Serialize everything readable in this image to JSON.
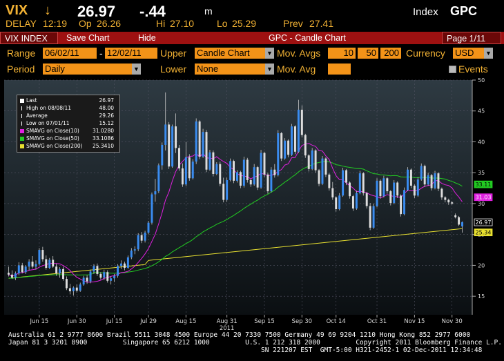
{
  "header": {
    "ticker": "VIX",
    "arrow": "↓",
    "price": "26.97",
    "change": "-.44",
    "unit": "m",
    "index_label": "Index",
    "index_code": "GPC",
    "delay": "DELAY",
    "time": "12:19",
    "op_label": "Op",
    "op": "26.26",
    "hi_label": "Hi",
    "hi": "27.10",
    "lo_label": "Lo",
    "lo": "25.29",
    "prev_label": "Prev",
    "prev": "27.41"
  },
  "toolbar": {
    "tab": "VIX INDEX",
    "save_chart": "Save Chart",
    "hide": "Hide",
    "title": "GPC - Candle Chart",
    "page": "Page 1/11"
  },
  "controls": {
    "range_label": "Range",
    "range_from": "06/02/11",
    "range_sep": "-",
    "range_to": "12/02/11",
    "upper_label": "Upper",
    "upper_value": "Candle Chart",
    "movavgs_label": "Mov. Avgs",
    "ma1": "10",
    "ma2": "50",
    "ma3": "200",
    "currency_label": "Currency",
    "currency_value": "USD",
    "period_label": "Period",
    "period_value": "Daily",
    "lower_label": "Lower",
    "lower_value": "None",
    "movavg_label": "Mov. Avg",
    "movavg_value": "",
    "events_label": "Events"
  },
  "legend": [
    {
      "label": "Last",
      "value": "26.97",
      "color": "#ffffff",
      "kind": "box"
    },
    {
      "label": "High on 08/08/11",
      "value": "48.00",
      "color": "#ffffff",
      "kind": "high"
    },
    {
      "label": "Average",
      "value": "29.26",
      "color": "#ffffff",
      "kind": "avg"
    },
    {
      "label": "Low on 07/01/11",
      "value": "15.12",
      "color": "#ffffff",
      "kind": "low"
    },
    {
      "label": "SMAVG on Close(10)",
      "value": "31.0280",
      "color": "#e020e0",
      "kind": "box"
    },
    {
      "label": "SMAVG on Close(50)",
      "value": "33.1086",
      "color": "#22cc22",
      "kind": "box"
    },
    {
      "label": "SMAVG on Close(200)",
      "value": "25.3410",
      "color": "#e8e030",
      "kind": "box"
    }
  ],
  "footer": {
    "line1": "Australia 61 2 9777 8600 Brazil 5511 3048 4500 Europe 44 20 7330 7500 Germany 49 69 9204 1210 Hong Kong 852 2977 6000",
    "line2": "Japan 81 3 3201 8900         Singapore 65 6212 1000         U.S. 1 212 318 2000         Copyright 2011 Bloomberg Finance L.P.",
    "line3": "SN 221207 EST  GMT-5:00 H321-2452-1 02-Dec-2011 12:34:48"
  },
  "chart_data": {
    "type": "candlestick",
    "ylim": [
      12,
      50
    ],
    "yticks": [
      15,
      20,
      25,
      30,
      35,
      40,
      45,
      50
    ],
    "xtick_labels": [
      "Jun 15",
      "Jun 30",
      "Jul 15",
      "Jul 29",
      "Aug 15",
      "Aug 31",
      "Sep 15",
      "Sep 30",
      "Oct 14",
      "Oct 31",
      "Nov 15",
      "Nov 30"
    ],
    "xtick_index": [
      9,
      20,
      31,
      41,
      52,
      64,
      75,
      86,
      96,
      108,
      119,
      130
    ],
    "year_label": "2011",
    "year_index": 64,
    "colors": {
      "up": "#3a8cf0",
      "down": "#dddddd",
      "ma10": "#e020e0",
      "ma50": "#22cc22",
      "ma200": "#e8e030"
    },
    "right_labels": [
      {
        "text": "33.11",
        "value": 33.11,
        "bg": "#22cc22",
        "fg": "#000"
      },
      {
        "text": "31.03",
        "value": 31.03,
        "bg": "#e020e0",
        "fg": "#fff"
      },
      {
        "text": "26.97",
        "value": 26.97,
        "bg": "#000000",
        "fg": "#fff"
      },
      {
        "text": "25.34",
        "value": 25.34,
        "bg": "#e8e030",
        "fg": "#000"
      }
    ],
    "candles": [
      [
        18.8,
        19.8,
        18.2,
        18.5
      ],
      [
        18.5,
        19.2,
        17.8,
        18.0
      ],
      [
        18.0,
        19.0,
        17.6,
        18.7
      ],
      [
        18.7,
        20.5,
        18.4,
        20.0
      ],
      [
        20.0,
        20.4,
        18.7,
        18.9
      ],
      [
        18.9,
        20.0,
        18.6,
        19.8
      ],
      [
        19.8,
        21.0,
        19.2,
        20.6
      ],
      [
        20.6,
        21.5,
        19.5,
        19.8
      ],
      [
        19.8,
        20.8,
        19.3,
        20.2
      ],
      [
        20.2,
        22.8,
        20.0,
        22.5
      ],
      [
        22.5,
        23.0,
        20.6,
        21.0
      ],
      [
        21.0,
        21.6,
        19.3,
        19.6
      ],
      [
        19.6,
        21.2,
        19.4,
        20.9
      ],
      [
        20.9,
        21.5,
        19.6,
        19.8
      ],
      [
        19.8,
        20.3,
        18.3,
        18.7
      ],
      [
        18.7,
        19.7,
        18.0,
        19.4
      ],
      [
        19.4,
        19.8,
        17.5,
        17.8
      ],
      [
        17.8,
        18.2,
        16.0,
        16.3
      ],
      [
        16.3,
        17.0,
        15.3,
        15.8
      ],
      [
        15.8,
        16.6,
        15.1,
        16.4
      ],
      [
        16.4,
        16.9,
        15.6,
        15.9
      ],
      [
        15.9,
        17.2,
        15.7,
        16.9
      ],
      [
        16.9,
        18.3,
        16.7,
        18.0
      ],
      [
        18.0,
        18.4,
        17.0,
        17.4
      ],
      [
        17.4,
        19.3,
        17.1,
        19.0
      ],
      [
        19.0,
        20.2,
        18.6,
        19.9
      ],
      [
        19.9,
        20.3,
        18.3,
        18.6
      ],
      [
        18.6,
        18.9,
        17.7,
        18.0
      ],
      [
        18.0,
        19.3,
        17.6,
        18.9
      ],
      [
        18.9,
        19.2,
        17.2,
        17.5
      ],
      [
        17.5,
        18.2,
        16.9,
        17.9
      ],
      [
        17.9,
        18.6,
        17.3,
        18.3
      ],
      [
        18.3,
        20.2,
        18.0,
        19.9
      ],
      [
        19.9,
        20.8,
        19.4,
        20.3
      ],
      [
        20.3,
        20.6,
        19.2,
        19.6
      ],
      [
        19.6,
        21.6,
        19.4,
        21.3
      ],
      [
        21.3,
        22.8,
        21.0,
        22.4
      ],
      [
        22.4,
        23.1,
        21.8,
        22.6
      ],
      [
        22.6,
        25.2,
        22.3,
        24.9
      ],
      [
        24.9,
        25.4,
        23.6,
        24.0
      ],
      [
        24.0,
        25.6,
        23.7,
        25.3
      ],
      [
        25.3,
        27.2,
        25.0,
        26.9
      ],
      [
        26.9,
        31.8,
        26.6,
        31.5
      ],
      [
        31.5,
        34.0,
        30.3,
        32.0
      ],
      [
        32.0,
        36.5,
        31.7,
        36.2
      ],
      [
        36.2,
        39.9,
        35.5,
        39.5
      ],
      [
        39.5,
        48.0,
        38.6,
        42.8
      ],
      [
        42.8,
        43.2,
        35.6,
        36.0
      ],
      [
        36.0,
        42.8,
        35.8,
        42.5
      ],
      [
        42.5,
        44.6,
        38.2,
        39.0
      ],
      [
        39.0,
        39.5,
        35.3,
        35.7
      ],
      [
        35.7,
        36.5,
        32.7,
        33.1
      ],
      [
        33.1,
        40.0,
        32.8,
        37.5
      ],
      [
        37.5,
        38.0,
        33.7,
        34.1
      ],
      [
        34.1,
        37.2,
        33.9,
        36.8
      ],
      [
        36.8,
        43.8,
        36.4,
        43.3
      ],
      [
        43.3,
        43.5,
        37.2,
        37.6
      ],
      [
        37.6,
        42.1,
        37.4,
        41.6
      ],
      [
        41.6,
        41.9,
        35.1,
        35.5
      ],
      [
        35.5,
        38.7,
        35.3,
        38.3
      ],
      [
        38.3,
        38.6,
        34.4,
        34.8
      ],
      [
        34.8,
        36.7,
        34.6,
        36.4
      ],
      [
        36.4,
        36.8,
        32.8,
        33.2
      ],
      [
        33.2,
        34.2,
        30.2,
        30.6
      ],
      [
        30.6,
        34.2,
        30.3,
        33.8
      ],
      [
        33.8,
        37.3,
        33.6,
        36.9
      ],
      [
        36.9,
        37.1,
        33.3,
        33.7
      ],
      [
        33.7,
        35.4,
        33.4,
        35.1
      ],
      [
        35.1,
        35.3,
        32.5,
        32.9
      ],
      [
        32.9,
        37.6,
        32.6,
        37.1
      ],
      [
        37.1,
        37.4,
        33.4,
        33.8
      ],
      [
        33.8,
        34.0,
        32.7,
        33.1
      ],
      [
        33.1,
        36.4,
        32.9,
        35.9
      ],
      [
        35.9,
        36.1,
        32.2,
        32.6
      ],
      [
        32.6,
        38.7,
        32.4,
        38.2
      ],
      [
        38.2,
        38.4,
        34.3,
        34.7
      ],
      [
        34.7,
        35.0,
        31.6,
        32.0
      ],
      [
        32.0,
        35.9,
        31.8,
        35.5
      ],
      [
        35.5,
        36.4,
        34.2,
        34.6
      ],
      [
        34.6,
        41.9,
        34.4,
        41.4
      ],
      [
        41.4,
        41.6,
        36.9,
        37.3
      ],
      [
        37.3,
        40.6,
        37.1,
        40.2
      ],
      [
        40.2,
        40.4,
        37.5,
        37.9
      ],
      [
        37.9,
        42.9,
        37.7,
        42.5
      ],
      [
        42.5,
        42.7,
        38.0,
        38.4
      ],
      [
        38.4,
        46.8,
        38.2,
        45.2
      ],
      [
        45.2,
        45.9,
        40.7,
        41.1
      ],
      [
        41.1,
        41.3,
        37.4,
        37.8
      ],
      [
        37.8,
        38.0,
        35.2,
        35.6
      ],
      [
        35.6,
        39.0,
        35.4,
        38.6
      ],
      [
        38.6,
        38.8,
        35.0,
        35.4
      ],
      [
        35.4,
        35.6,
        32.8,
        33.2
      ],
      [
        33.2,
        37.7,
        33.0,
        37.3
      ],
      [
        37.3,
        37.5,
        34.3,
        34.7
      ],
      [
        34.7,
        34.9,
        32.1,
        32.5
      ],
      [
        32.5,
        33.5,
        30.6,
        31.0
      ],
      [
        31.0,
        31.2,
        28.7,
        29.1
      ],
      [
        29.1,
        31.7,
        28.9,
        31.3
      ],
      [
        31.3,
        35.8,
        31.1,
        35.4
      ],
      [
        35.4,
        35.6,
        33.0,
        33.4
      ],
      [
        33.4,
        33.6,
        30.8,
        31.2
      ],
      [
        31.2,
        31.4,
        28.8,
        29.2
      ],
      [
        29.2,
        32.1,
        29.0,
        31.7
      ],
      [
        31.7,
        35.3,
        31.5,
        34.9
      ],
      [
        34.9,
        35.1,
        31.3,
        31.7
      ],
      [
        31.7,
        31.9,
        29.2,
        29.6
      ],
      [
        29.6,
        30.1,
        25.7,
        26.1
      ],
      [
        26.1,
        30.0,
        25.9,
        29.6
      ],
      [
        29.6,
        34.1,
        29.4,
        33.7
      ],
      [
        33.7,
        33.9,
        30.8,
        31.2
      ],
      [
        31.2,
        34.5,
        31.0,
        34.1
      ],
      [
        34.1,
        34.3,
        31.6,
        32.0
      ],
      [
        32.0,
        32.2,
        29.7,
        30.1
      ],
      [
        30.1,
        33.8,
        29.9,
        33.4
      ],
      [
        33.4,
        33.6,
        30.9,
        31.3
      ],
      [
        31.3,
        31.5,
        27.9,
        28.3
      ],
      [
        28.3,
        32.6,
        28.1,
        32.2
      ],
      [
        32.2,
        35.9,
        32.0,
        35.5
      ],
      [
        35.5,
        35.7,
        32.5,
        32.9
      ],
      [
        32.9,
        33.1,
        30.9,
        31.3
      ],
      [
        31.3,
        34.3,
        31.1,
        33.9
      ],
      [
        33.9,
        36.5,
        33.7,
        36.1
      ],
      [
        36.1,
        36.3,
        32.7,
        33.1
      ],
      [
        33.1,
        35.0,
        32.9,
        34.6
      ],
      [
        34.6,
        34.8,
        32.1,
        32.5
      ],
      [
        32.5,
        35.3,
        32.3,
        34.9
      ],
      [
        34.9,
        35.1,
        32.0,
        32.4
      ],
      [
        32.4,
        32.6,
        30.6,
        31.0
      ],
      [
        31.0,
        31.2,
        30.2,
        30.6
      ],
      [
        30.6,
        30.8,
        29.8,
        30.2
      ],
      [
        30.2,
        30.4,
        29.8,
        30.0
      ],
      [
        28.1,
        28.4,
        27.6,
        27.8
      ],
      [
        27.8,
        28.0,
        26.4,
        26.6
      ],
      [
        26.3,
        27.1,
        25.3,
        27.0
      ]
    ]
  }
}
